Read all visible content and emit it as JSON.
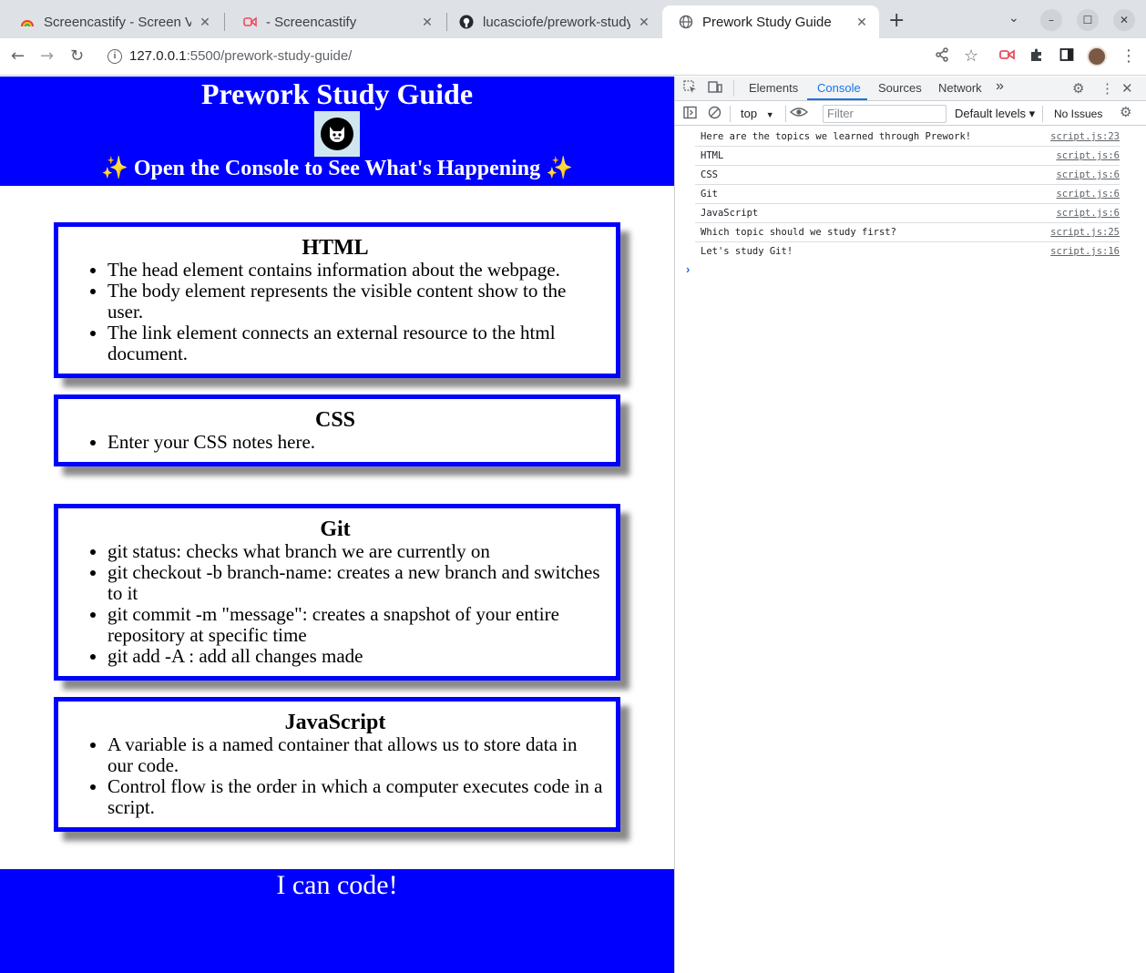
{
  "browser": {
    "tabs": [
      {
        "title": "Screencastify - Screen Vid",
        "favicon": "screencastify-rainbow-icon",
        "active": false
      },
      {
        "title": "- Screencastify",
        "favicon": "screencastify-icon",
        "active": false
      },
      {
        "title": "lucasciofe/prework-study",
        "favicon": "github-icon",
        "active": false
      },
      {
        "title": "Prework Study Guide",
        "favicon": "globe-icon",
        "active": true
      }
    ],
    "new_tab": "+",
    "url_host": "127.0.0.1",
    "url_path": ":5500/prework-study-guide/",
    "accent": "#1a73e8"
  },
  "page": {
    "title": "Prework Study Guide",
    "subtitle": "✨ Open the Console to See What's Happening ✨",
    "header_color": "#0000ff",
    "sections": [
      {
        "heading": "HTML",
        "items": [
          "The head element contains information about the webpage.",
          "The body element represents the visible content show to the user.",
          "The link element connects an external resource to the html document."
        ]
      },
      {
        "heading": "CSS",
        "items": [
          "Enter your CSS notes here."
        ]
      },
      {
        "heading": "Git",
        "items": [
          "git status: checks what branch we are currently on",
          "git checkout -b branch-name: creates a new branch and switches to it",
          "git commit -m \"message\": creates a snapshot of your entire repository at specific time",
          "git add -A : add all changes made"
        ]
      },
      {
        "heading": "JavaScript",
        "items": [
          "A variable is a named container that allows us to store data in our code.",
          "Control flow is the order in which a computer executes code in a script."
        ]
      }
    ],
    "footer": "I can code!"
  },
  "devtools": {
    "tabs": [
      "Elements",
      "Console",
      "Sources",
      "Network"
    ],
    "active_tab": "Console",
    "more": "»",
    "context": "top",
    "filter_placeholder": "Filter",
    "levels": "Default levels ▾",
    "issues": "No Issues",
    "logs": [
      {
        "message": "Here are the topics we learned through Prework!",
        "source": "script.js:23"
      },
      {
        "message": "HTML",
        "source": "script.js:6"
      },
      {
        "message": "CSS",
        "source": "script.js:6"
      },
      {
        "message": "Git",
        "source": "script.js:6"
      },
      {
        "message": "JavaScript",
        "source": "script.js:6"
      },
      {
        "message": "Which topic should we study first?",
        "source": "script.js:25"
      },
      {
        "message": "Let's study Git!",
        "source": "script.js:16"
      }
    ],
    "prompt": "›"
  }
}
